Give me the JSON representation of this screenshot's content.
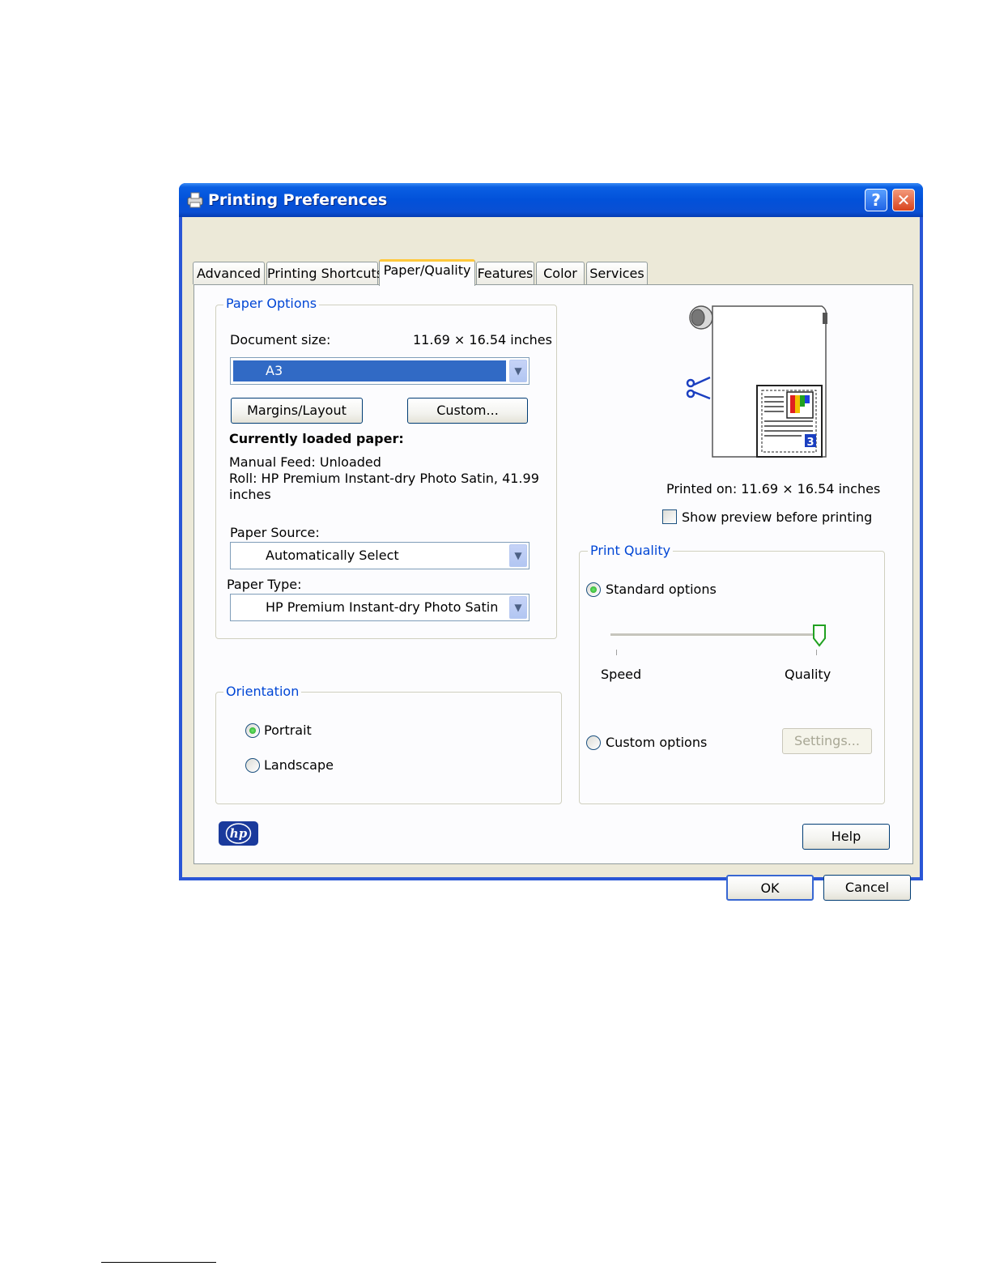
{
  "window": {
    "title": "Printing Preferences",
    "help_glyph": "?",
    "close_glyph": "✕"
  },
  "tabs": [
    {
      "label": "Advanced",
      "active": false
    },
    {
      "label": "Printing Shortcuts",
      "active": false
    },
    {
      "label": "Paper/Quality",
      "active": true
    },
    {
      "label": "Features",
      "active": false
    },
    {
      "label": "Color",
      "active": false
    },
    {
      "label": "Services",
      "active": false
    }
  ],
  "paper_options": {
    "group_label": "Paper Options",
    "document_size_label": "Document size:",
    "document_size_value": "11.69 × 16.54 inches",
    "size_selected": "A3",
    "margins_button": "Margins/Layout",
    "custom_button": "Custom...",
    "loaded_paper_heading": "Currently loaded paper:",
    "loaded_lines": [
      "Manual Feed: Unloaded",
      "Roll:  HP Premium Instant-dry Photo Satin, 41.99",
      "inches"
    ],
    "paper_source_label": "Paper Source:",
    "paper_source_value": "Automatically Select",
    "paper_type_label": "Paper Type:",
    "paper_type_value": "HP Premium Instant-dry Photo Satin"
  },
  "orientation": {
    "group_label": "Orientation",
    "portrait_label": "Portrait",
    "landscape_label": "Landscape",
    "selected": "Portrait"
  },
  "preview": {
    "printed_on": "Printed on: 11.69 × 16.54 inches",
    "show_preview_label": "Show preview before printing",
    "show_preview_checked": false
  },
  "print_quality": {
    "group_label": "Print Quality",
    "standard_label": "Standard options",
    "speed_label": "Speed",
    "quality_label": "Quality",
    "slider_position": 1.0,
    "custom_label": "Custom options",
    "settings_button": "Settings...",
    "selected": "Standard options"
  },
  "footer": {
    "logo_text": "hp",
    "help_button": "Help",
    "ok_button": "OK",
    "cancel_button": "Cancel"
  },
  "colors": {
    "titlebar": "#0251d9",
    "group_label": "#0046d5",
    "selection": "#316ac5",
    "tab_highlight": "#ffc83c",
    "hp_logo": "#1a3a9c"
  }
}
